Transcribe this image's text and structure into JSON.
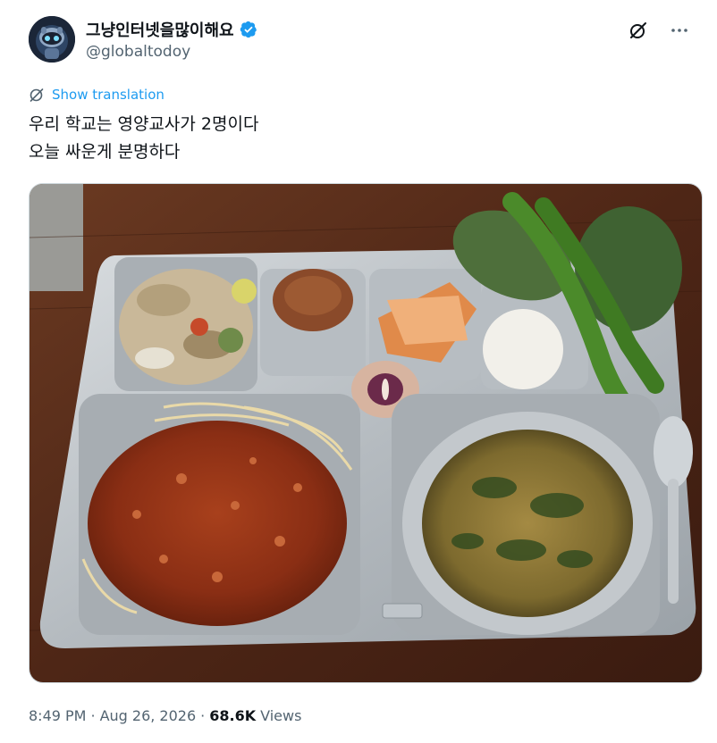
{
  "author": {
    "display_name": "그냥인터넷을많이해요",
    "handle": "@globaltodoy",
    "verified": true,
    "avatar_icon": "robot-avatar"
  },
  "actions": {
    "grok_icon": "grok-slash-circle-icon",
    "more_icon": "more-dots-icon"
  },
  "translation": {
    "label": "Show translation",
    "icon": "globe-slash-icon"
  },
  "tweet": {
    "lines": [
      "우리 학교는 영양교사가 2명이다",
      "오늘 싸운게 분명하다"
    ]
  },
  "media": {
    "alt": "school lunch tray with jjajang sauce, noodles, soup, kimchi, rice, peppers and perilla leaves"
  },
  "meta": {
    "time": "8:49 PM",
    "date": "Aug 26, 2026",
    "views_count": "68.6K",
    "views_label": "Views"
  },
  "colors": {
    "link": "#1d9bf0",
    "secondary_text": "#536471",
    "verified_badge": "#1d9bf0"
  }
}
